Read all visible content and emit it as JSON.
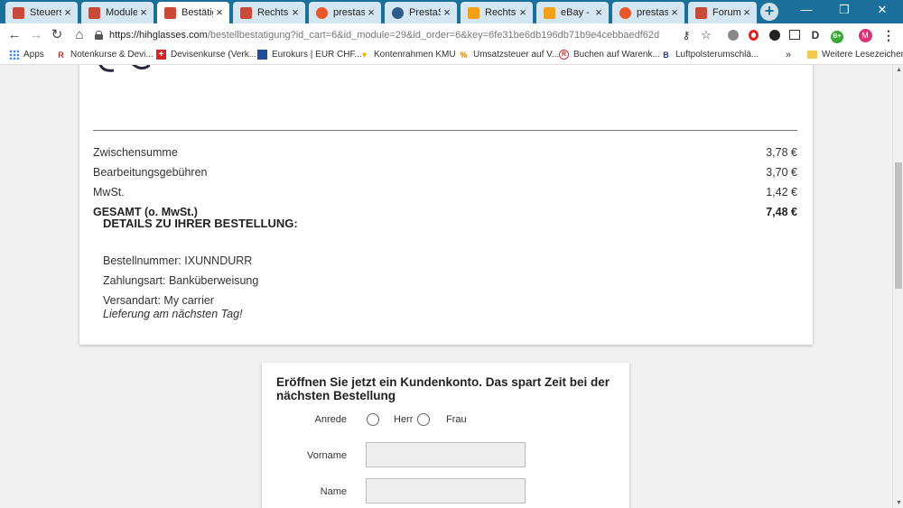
{
  "tabs": [
    {
      "title": "Steuersat",
      "favicon": "#c84a3a"
    },
    {
      "title": "Module |",
      "favicon": "#c84a3a"
    },
    {
      "title": "Bestätigu",
      "favicon": "#c84a3a",
      "active": true
    },
    {
      "title": "Rechtsko",
      "favicon": "#c84a3a"
    },
    {
      "title": "prestash",
      "favicon": "#e8572a"
    },
    {
      "title": "PrestaSh",
      "favicon": "#2d5b8b"
    },
    {
      "title": "Rechtsti",
      "favicon": "#f0a019"
    },
    {
      "title": "eBay - V",
      "favicon": "#f0a019"
    },
    {
      "title": "prestash",
      "favicon": "#e8572a"
    },
    {
      "title": "Forums",
      "favicon": "#c84a3a"
    }
  ],
  "window": {
    "new_tab": "+",
    "minimize": "—",
    "maximize": "❐",
    "close": "✕"
  },
  "toolbar": {
    "back": "←",
    "forward": "→",
    "reload": "↻",
    "home": "⌂",
    "url_host": "https://hihglasses.com",
    "url_rest": "/bestellbestatigung?id_cart=6&id_module=29&id_order=6&key=6fe31be6db196db71b9e4cebbaedf62d",
    "avatar_letter": "M",
    "extension_badge": "B+"
  },
  "bookmarks": [
    {
      "label": "Apps",
      "icon": "apps-icon"
    },
    {
      "label": "Notenkurse & Devi...",
      "icon": "r-logo-icon"
    },
    {
      "label": "Devisenkurse (Verk...",
      "icon": "swiss-flag-icon"
    },
    {
      "label": "Eurokurs | EUR CHF...",
      "icon": "chart-icon"
    },
    {
      "label": "Kontenrahmen KMU",
      "icon": "funnel-icon"
    },
    {
      "label": "Umsatzsteuer auf V...",
      "icon": "percent-icon"
    },
    {
      "label": "Buchen auf Warenk...",
      "icon": "circle-logo-icon"
    },
    {
      "label": "Luftpolsterumschlä...",
      "icon": "b-logo-icon"
    }
  ],
  "bookmarks_more": "»",
  "bookmarks_other": "Weitere Lesezeichen",
  "summary": {
    "rows": [
      {
        "label": "Zwischensumme",
        "value": "3,78 €"
      },
      {
        "label": "Bearbeitungsgebühren",
        "value": "3,70 €"
      },
      {
        "label": "MwSt.",
        "value": "1,42 €"
      }
    ],
    "total": {
      "label": "GESAMT (o. MwSt.)",
      "value": "7,48 €"
    }
  },
  "details": {
    "title": "DETAILS ZU IHRER BESTELLUNG:",
    "order_number": "Bestellnummer: IXUNNDURR",
    "payment": "Zahlungsart: Banküberweisung",
    "shipping": "Versandart: My carrier",
    "delivery_note": "Lieferung am nächsten Tag!"
  },
  "registration": {
    "title": "Eröffnen Sie jetzt ein Kundenkonto. Das spart Zeit bei der nächsten Bestellung",
    "salutation_label": "Anrede",
    "salutation_options": [
      "Herr",
      "Frau"
    ],
    "firstname_label": "Vorname",
    "firstname_value": "",
    "lastname_label": "Name",
    "lastname_value": ""
  }
}
